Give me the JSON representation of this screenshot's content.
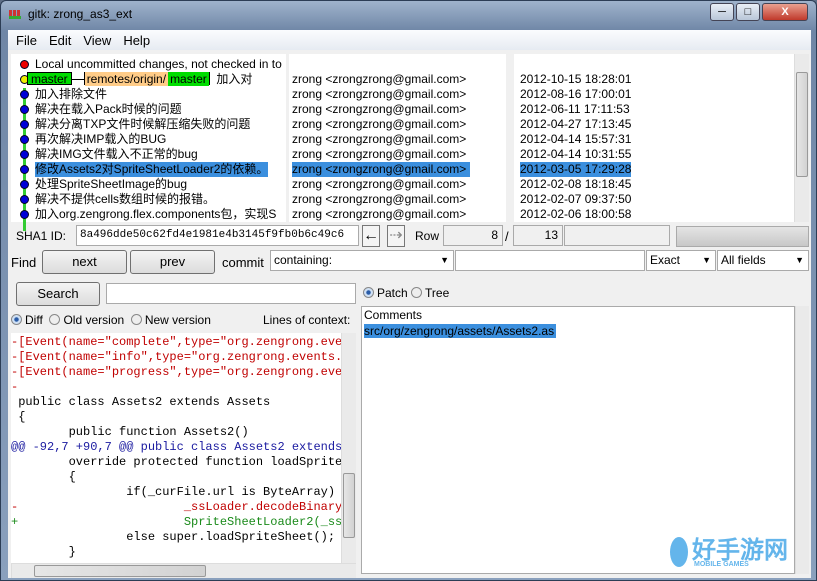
{
  "window": {
    "title": "gitk: zrong_as3_ext",
    "minimize": "─",
    "maximize": "□",
    "close": "X"
  },
  "menu": [
    "File",
    "Edit",
    "View",
    "Help"
  ],
  "commits": [
    {
      "message": "Local uncommitted changes, not checked in to index",
      "author": "",
      "date": "",
      "node": "red"
    },
    {
      "message": "加入对",
      "author": "zrong <zrongzrong@gmail.com>",
      "date": "2012-10-15 18:28:01",
      "node": "yellow",
      "refs": {
        "head": "master",
        "remote_prefix": "remotes/origin/",
        "remote_branch": "master"
      }
    },
    {
      "message": "加入排除文件",
      "author": "zrong <zrongzrong@gmail.com>",
      "date": "2012-08-16 17:00:01",
      "node": "blue"
    },
    {
      "message": "解决在载入Pack时候的问题",
      "author": "zrong <zrongzrong@gmail.com>",
      "date": "2012-06-11 17:11:53",
      "node": "blue"
    },
    {
      "message": "解决分离TXP文件时候解压缩失败的问题",
      "author": "zrong <zrongzrong@gmail.com>",
      "date": "2012-04-27 17:13:45",
      "node": "blue"
    },
    {
      "message": "再次解决IMP载入的BUG",
      "author": "zrong <zrongzrong@gmail.com>",
      "date": "2012-04-14 15:57:31",
      "node": "blue"
    },
    {
      "message": "解决IMG文件载入不正常的bug",
      "author": "zrong <zrongzrong@gmail.com>",
      "date": "2012-04-14 10:31:55",
      "node": "blue"
    },
    {
      "message": "修改Assets2对SpriteSheetLoader2的依赖。",
      "author": "zrong <zrongzrong@gmail.com>",
      "date": "2012-03-05 17:29:28",
      "node": "blue",
      "selected": true
    },
    {
      "message": "处理SpriteSheetImage的bug",
      "author": "zrong <zrongzrong@gmail.com>",
      "date": "2012-02-08 18:18:45",
      "node": "blue"
    },
    {
      "message": "解决不提供cells数组时候的报错。",
      "author": "zrong <zrongzrong@gmail.com>",
      "date": "2012-02-07 09:37:50",
      "node": "blue"
    },
    {
      "message": "加入org.zengrong.flex.components包，实现S",
      "author": "zrong <zrongzrong@gmail.com>",
      "date": "2012-02-06 18:00:58",
      "node": "blue"
    }
  ],
  "sha": {
    "label": "SHA1 ID:",
    "value": "8a496dde50c62fd4e1981e4b3145f9fb0b6c49c6",
    "row_label": "Row",
    "row": "8",
    "sep": "/",
    "total": "13"
  },
  "find": {
    "label": "Find",
    "next": "next",
    "prev": "prev",
    "commit_label": "commit",
    "mode": "containing:",
    "query": "",
    "match": "Exact",
    "fields": "All fields"
  },
  "search": {
    "button": "Search",
    "value": ""
  },
  "diff_options": {
    "diff": "Diff",
    "old": "Old version",
    "new": "New version",
    "context_label": "Lines of context:",
    "selected": "Diff"
  },
  "view_options": {
    "patch": "Patch",
    "tree": "Tree",
    "selected": "Patch"
  },
  "files": {
    "header": "Comments",
    "items": [
      "src/org/zengrong/assets/Assets2.as"
    ]
  },
  "diff_lines": [
    {
      "type": "del",
      "text": "-[Event(name=\"complete\",type=\"org.zengrong.ever"
    },
    {
      "type": "del",
      "text": "-[Event(name=\"info\",type=\"org.zengrong.events.]"
    },
    {
      "type": "del",
      "text": "-[Event(name=\"progress\",type=\"org.zengrong.ever"
    },
    {
      "type": "del",
      "text": "-"
    },
    {
      "type": "ctx",
      "text": " public class Assets2 extends Assets"
    },
    {
      "type": "ctx",
      "text": " {"
    },
    {
      "type": "ctx",
      "text": "        public function Assets2()"
    },
    {
      "type": "hunk",
      "text": "@@ -92,7 +90,7 @@ public class Assets2 extends"
    },
    {
      "type": "ctx",
      "text": "        override protected function loadSprite"
    },
    {
      "type": "ctx",
      "text": "        {"
    },
    {
      "type": "ctx",
      "text": "                if(_curFile.url is ByteArray)"
    },
    {
      "type": "del",
      "text": "-                       _ssLoader.decodeBinary"
    },
    {
      "type": "add",
      "text": "+                       SpriteSheetLoader2(_ss"
    },
    {
      "type": "ctx",
      "text": "                else super.loadSpriteSheet();"
    },
    {
      "type": "ctx",
      "text": "        }"
    }
  ],
  "watermark": {
    "text": "好手游网",
    "sub": "MOBILE GAMES"
  },
  "colors": {
    "selection": "#3b8fde",
    "graph_line": "#33cc33",
    "head_tag": "#00dd00",
    "remote_tag": "#ffcc88",
    "deleted": "#c00000",
    "added": "#1a8a1a",
    "hunk": "#1a1aa0"
  }
}
